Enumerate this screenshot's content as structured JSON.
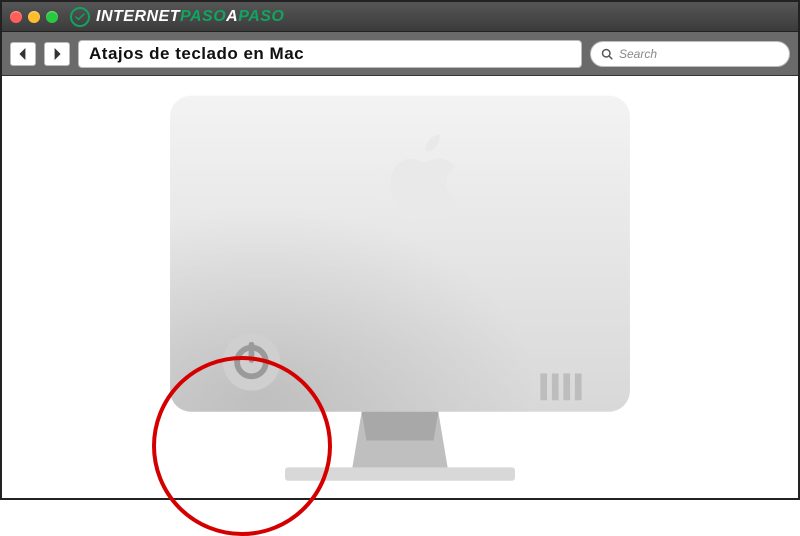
{
  "titlebar": {
    "brand_part1": "INTERNET",
    "brand_part2": "PASO",
    "brand_part3": "A",
    "brand_part4": "PASO"
  },
  "toolbar": {
    "address_text": "Atajos de teclado en Mac",
    "search_placeholder": "Search"
  },
  "colors": {
    "accent_green": "#11a460",
    "highlight_red": "#d40000"
  },
  "illustration": {
    "subject": "iMac rear view",
    "highlighted_feature": "power-button"
  }
}
